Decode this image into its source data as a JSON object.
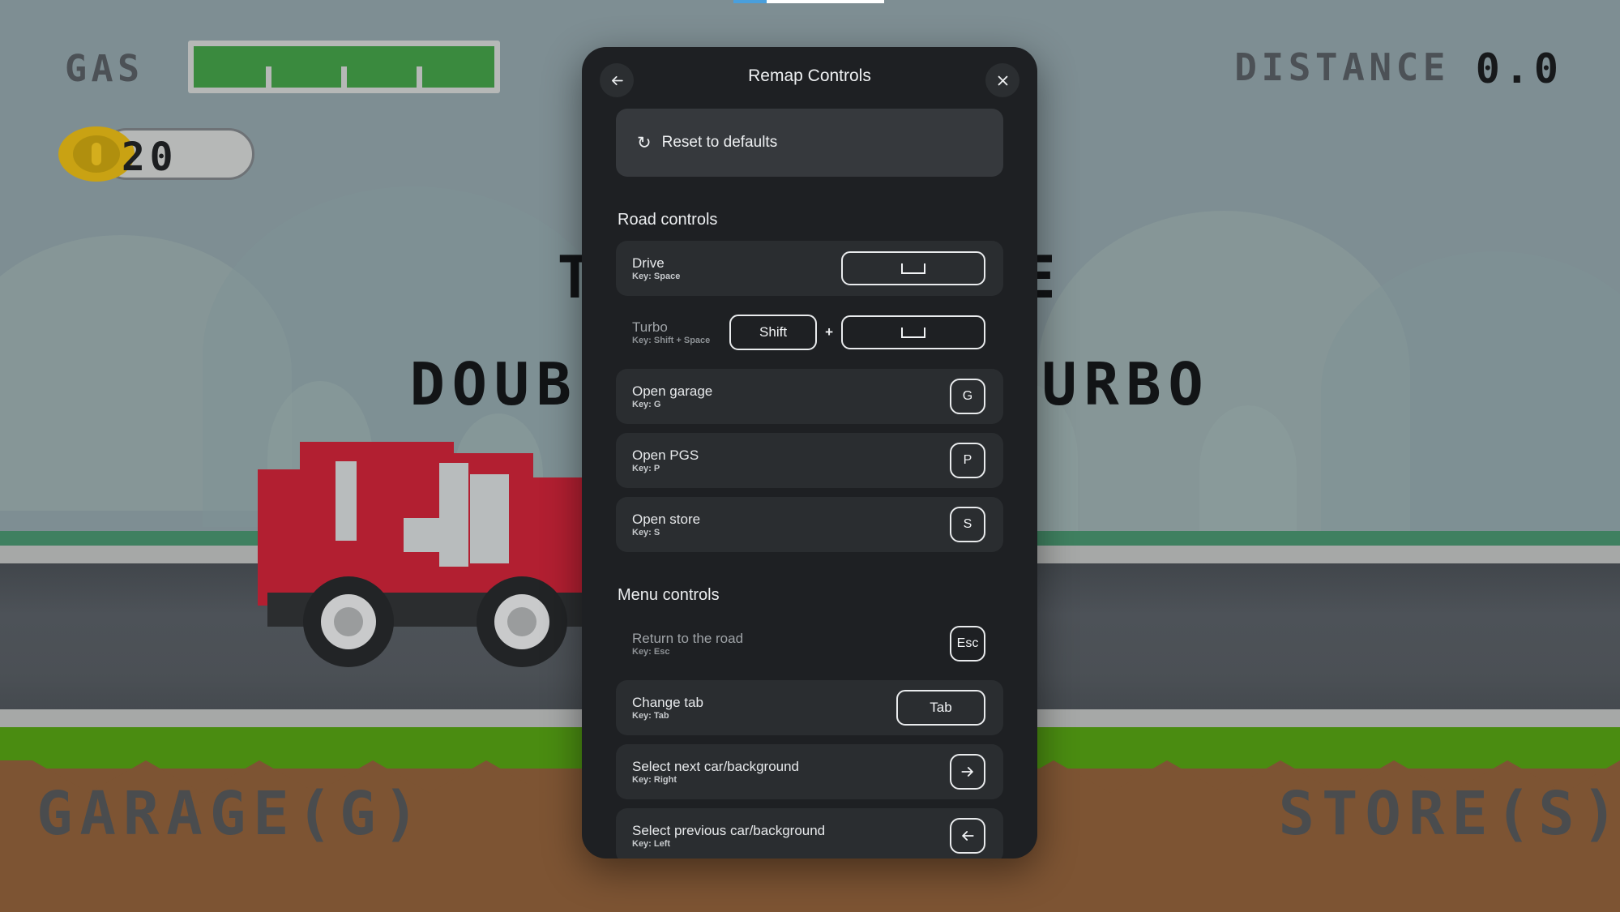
{
  "hud": {
    "gas_label": "GAS",
    "gas_percent": 100,
    "coin_count": "20",
    "distance_label": "DISTANCE",
    "distance_value": "0.0",
    "tap_line_1": "TAP TO DRIVE",
    "tap_line_2": "DOUBLE TAP TO TURBO",
    "garage_label": "GARAGE(G)",
    "store_label": "STORE(S)"
  },
  "loading_bar": {
    "progress_percent": 22
  },
  "modal": {
    "title": "Remap Controls",
    "back_icon": "arrow-left-icon",
    "close_icon": "close-icon",
    "reset": {
      "label": "Reset to defaults",
      "icon": "rotate-ccw-icon"
    },
    "sections": [
      {
        "title": "Road controls",
        "rows": [
          {
            "name": "Drive",
            "sub": "Key: Space",
            "highlighted": true,
            "keys": [
              {
                "type": "space",
                "label": "",
                "size": "wide"
              }
            ]
          },
          {
            "name": "Turbo",
            "sub": "Key: Shift + Space",
            "highlighted": false,
            "keys": [
              {
                "type": "text",
                "label": "Shift",
                "size": "mid"
              },
              {
                "type": "plus",
                "label": "+"
              },
              {
                "type": "space",
                "label": "",
                "size": "wide"
              }
            ]
          },
          {
            "name": "Open garage",
            "sub": "Key: G",
            "highlighted": true,
            "keys": [
              {
                "type": "text",
                "label": "G",
                "size": "sq"
              }
            ]
          },
          {
            "name": "Open PGS",
            "sub": "Key: P",
            "highlighted": true,
            "keys": [
              {
                "type": "text",
                "label": "P",
                "size": "sq"
              }
            ]
          },
          {
            "name": "Open store",
            "sub": "Key: S",
            "highlighted": true,
            "keys": [
              {
                "type": "text",
                "label": "S",
                "size": "sq"
              }
            ]
          }
        ]
      },
      {
        "title": "Menu controls",
        "rows": [
          {
            "name": "Return to the road",
            "sub": "Key: Esc",
            "highlighted": false,
            "keys": [
              {
                "type": "text",
                "label": "Esc",
                "size": "sq"
              }
            ]
          },
          {
            "name": "Change tab",
            "sub": "Key: Tab",
            "highlighted": true,
            "keys": [
              {
                "type": "text",
                "label": "Tab",
                "size": "tab"
              }
            ]
          },
          {
            "name": "Select next car/background",
            "sub": "Key: Right",
            "highlighted": true,
            "keys": [
              {
                "type": "icon",
                "label": "arrow-right-icon",
                "size": "sq"
              }
            ]
          },
          {
            "name": "Select previous car/background",
            "sub": "Key: Left",
            "highlighted": true,
            "keys": [
              {
                "type": "icon",
                "label": "arrow-left-icon",
                "size": "sq"
              }
            ]
          }
        ]
      }
    ]
  },
  "colors": {
    "sky": "#7e8e93",
    "road": "#4a4f54",
    "grass_near": "#4a8c11",
    "dirt": "#7d5433",
    "car_body": "#b21f31",
    "gas_fill": "#3a8a3e",
    "coin": "#c9a213",
    "modal_bg": "#1e2023",
    "row_bg": "#2a2d30",
    "accent_blue": "#4a9fdc"
  }
}
